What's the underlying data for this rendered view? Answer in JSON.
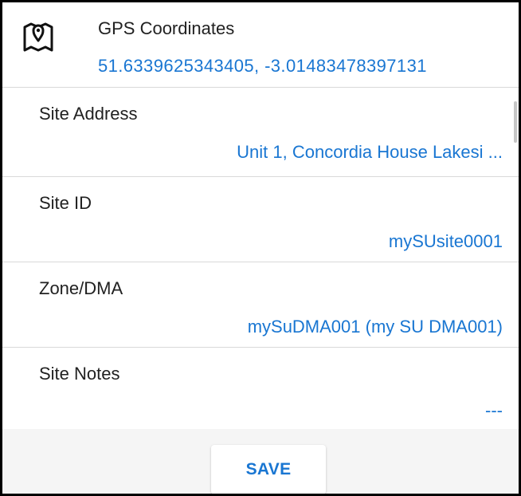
{
  "gps": {
    "icon": "map-pin-icon",
    "label": "GPS Coordinates",
    "value": "51.6339625343405, -3.01483478397131"
  },
  "site_address": {
    "label": "Site Address",
    "value": "Unit 1, Concordia House Lakesi ..."
  },
  "site_id": {
    "label": "Site ID",
    "value": "mySUsite0001"
  },
  "zone": {
    "label": "Zone/DMA",
    "value": "mySuDMA001 (my SU DMA001)"
  },
  "site_notes": {
    "label": "Site Notes",
    "value": "---"
  },
  "footer": {
    "save_label": "SAVE"
  },
  "colors": {
    "value_text": "#1976d2",
    "label_text": "#212121",
    "footer_bg": "#f5f5f5",
    "divider": "#d9d9d9"
  }
}
